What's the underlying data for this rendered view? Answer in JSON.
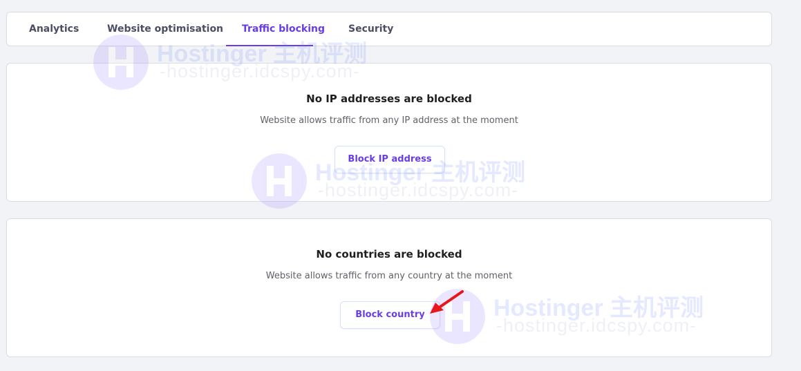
{
  "tabs": [
    {
      "label": "Analytics",
      "active": false
    },
    {
      "label": "Website optimisation",
      "active": false
    },
    {
      "label": "Traffic blocking",
      "active": true
    },
    {
      "label": "Security",
      "active": false
    }
  ],
  "ip_block": {
    "title": "No IP addresses are blocked",
    "description": "Website allows traffic from any IP address at the moment",
    "button_label": "Block IP address"
  },
  "country_block": {
    "title": "No countries are blocked",
    "description": "Website allows traffic from any country at the moment",
    "button_label": "Block country"
  },
  "watermark": {
    "brand": "Hostinger 主机评测",
    "domain": "-hostinger.idcspy.com-"
  },
  "colors": {
    "accent": "#673de6",
    "background": "#f2f3f6",
    "annotation_arrow": "#e8161b"
  }
}
